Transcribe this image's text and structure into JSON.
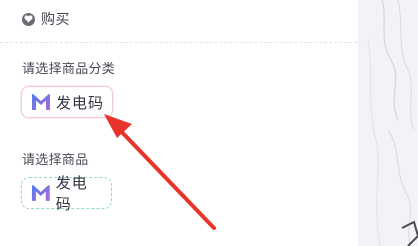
{
  "header": {
    "title": "购买",
    "icon": "heart-icon"
  },
  "category_section": {
    "label": "请选择商品分类",
    "selected_option": {
      "icon": "m-logo-icon",
      "label": "发电码"
    }
  },
  "product_section": {
    "label": "请选择商品",
    "option": {
      "icon": "m-logo-icon",
      "label": "发电码"
    }
  },
  "colors": {
    "selected_border": "#f2c9e3",
    "option_border": "#8fdcc5",
    "arrow": "#e8352b",
    "logo_gradient_start": "#5b7cf0",
    "logo_gradient_end": "#b26ad9"
  }
}
